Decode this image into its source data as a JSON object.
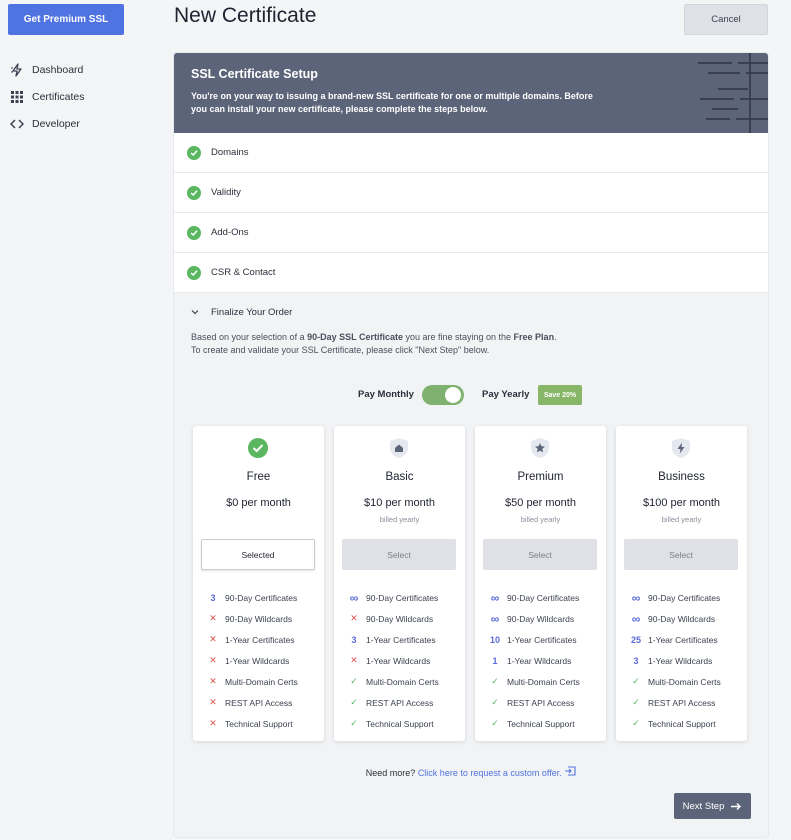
{
  "sidebar": {
    "premium_label": "Get Premium SSL",
    "items": [
      {
        "label": "Dashboard",
        "icon": "bolt-icon"
      },
      {
        "label": "Certificates",
        "icon": "grid-icon"
      },
      {
        "label": "Developer",
        "icon": "code-icon"
      }
    ]
  },
  "header": {
    "title": "New Certificate",
    "cancel_label": "Cancel"
  },
  "banner": {
    "title": "SSL Certificate Setup",
    "text": "You're on your way to issuing a brand-new SSL certificate for one or multiple domains. Before you can install your new certificate, please complete the steps below."
  },
  "steps": [
    {
      "label": "Domains"
    },
    {
      "label": "Validity"
    },
    {
      "label": "Add-Ons"
    },
    {
      "label": "CSR & Contact"
    }
  ],
  "finalize": {
    "title": "Finalize Your Order",
    "line1_prefix": "Based on your selection of a ",
    "line1_bold1": "90-Day SSL Certificate",
    "line1_mid": " you are fine staying on the ",
    "line1_bold2": "Free Plan",
    "line1_end": ".",
    "line2": "To create and validate your SSL Certificate, please click \"Next Step\" below."
  },
  "billing": {
    "monthly_label": "Pay Monthly",
    "yearly_label": "Pay Yearly",
    "save_badge": "Save 20%"
  },
  "plans": [
    {
      "name": "Free",
      "price": "$0 per month",
      "billed": "",
      "button": "Selected",
      "features": [
        {
          "mark": "3",
          "label": "90-Day Certificates"
        },
        {
          "mark": "✕",
          "label": "90-Day Wildcards"
        },
        {
          "mark": "✕",
          "label": "1-Year Certificates"
        },
        {
          "mark": "✕",
          "label": "1-Year Wildcards"
        },
        {
          "mark": "✕",
          "label": "Multi-Domain Certs"
        },
        {
          "mark": "✕",
          "label": "REST API Access"
        },
        {
          "mark": "✕",
          "label": "Technical Support"
        }
      ]
    },
    {
      "name": "Basic",
      "price": "$10 per month",
      "billed": "billed yearly",
      "button": "Select",
      "features": [
        {
          "mark": "∞",
          "label": "90-Day Certificates"
        },
        {
          "mark": "✕",
          "label": "90-Day Wildcards"
        },
        {
          "mark": "3",
          "label": "1-Year Certificates"
        },
        {
          "mark": "✕",
          "label": "1-Year Wildcards"
        },
        {
          "mark": "✓",
          "label": "Multi-Domain Certs"
        },
        {
          "mark": "✓",
          "label": "REST API Access"
        },
        {
          "mark": "✓",
          "label": "Technical Support"
        }
      ]
    },
    {
      "name": "Premium",
      "price": "$50 per month",
      "billed": "billed yearly",
      "button": "Select",
      "features": [
        {
          "mark": "∞",
          "label": "90-Day Certificates"
        },
        {
          "mark": "∞",
          "label": "90-Day Wildcards"
        },
        {
          "mark": "10",
          "label": "1-Year Certificates"
        },
        {
          "mark": "1",
          "label": "1-Year Wildcards"
        },
        {
          "mark": "✓",
          "label": "Multi-Domain Certs"
        },
        {
          "mark": "✓",
          "label": "REST API Access"
        },
        {
          "mark": "✓",
          "label": "Technical Support"
        }
      ]
    },
    {
      "name": "Business",
      "price": "$100 per month",
      "billed": "billed yearly",
      "button": "Select",
      "features": [
        {
          "mark": "∞",
          "label": "90-Day Certificates"
        },
        {
          "mark": "∞",
          "label": "90-Day Wildcards"
        },
        {
          "mark": "25",
          "label": "1-Year Certificates"
        },
        {
          "mark": "3",
          "label": "1-Year Wildcards"
        },
        {
          "mark": "✓",
          "label": "Multi-Domain Certs"
        },
        {
          "mark": "✓",
          "label": "REST API Access"
        },
        {
          "mark": "✓",
          "label": "Technical Support"
        }
      ]
    }
  ],
  "footer": {
    "need_more": "Need more?",
    "link": "Click here to request a custom offer.",
    "next_label": "Next Step"
  },
  "colors": {
    "accent": "#4f73e0",
    "banner": "#5b6478",
    "success": "#5ab760",
    "error": "#d9534f",
    "toggle": "#7fb26e"
  }
}
